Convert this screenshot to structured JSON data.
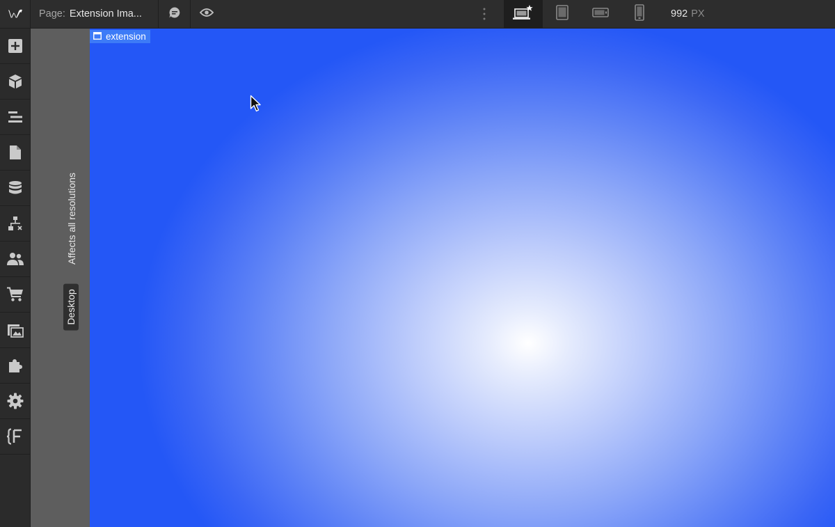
{
  "topbar": {
    "logo_icon": "webflow-logo-icon",
    "page_label": "Page:",
    "page_name": "Extension Ima...",
    "comments_icon": "comment-icon",
    "preview_icon": "eye-icon",
    "more_icon": "vertical-dots-icon",
    "breakpoints": [
      {
        "name": "desktop-base",
        "icon": "laptop-star-icon",
        "active": true
      },
      {
        "name": "tablet",
        "icon": "tablet-icon",
        "active": false
      },
      {
        "name": "mobile-landscape",
        "icon": "phone-landscape-icon",
        "active": false
      },
      {
        "name": "mobile-portrait",
        "icon": "phone-portrait-icon",
        "active": false
      }
    ],
    "width_value": "992",
    "width_unit": "PX"
  },
  "sidebar": {
    "items": [
      {
        "icon": "add-icon"
      },
      {
        "icon": "cube-icon"
      },
      {
        "icon": "navigator-icon"
      },
      {
        "icon": "page-icon"
      },
      {
        "icon": "database-icon"
      },
      {
        "icon": "logic-icon"
      },
      {
        "icon": "users-icon"
      },
      {
        "icon": "cart-icon"
      },
      {
        "icon": "assets-icon"
      },
      {
        "icon": "puzzle-icon"
      },
      {
        "icon": "gear-icon"
      },
      {
        "icon": "variables-icon"
      }
    ]
  },
  "breakpoint_strip": {
    "note": "Affects all resolutions",
    "badge": "Desktop"
  },
  "canvas": {
    "selected_element_label": "extension",
    "colors": {
      "edge": "#2457f6",
      "center": "#ffffff",
      "tag": "#3d7bf7"
    }
  }
}
